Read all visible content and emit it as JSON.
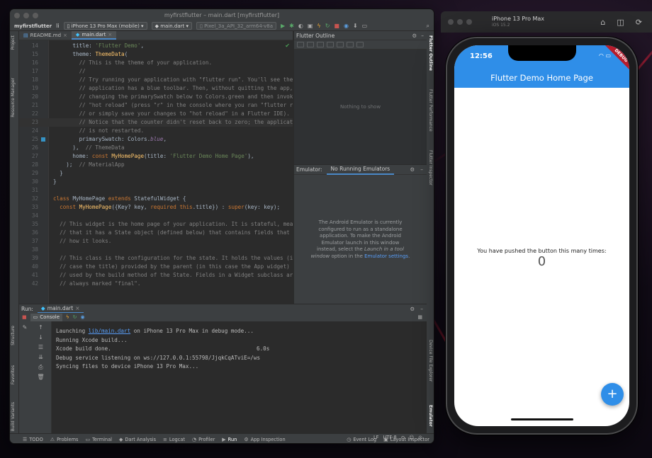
{
  "ide": {
    "title": "myfirstflutter – main.dart [myfirstflutter]",
    "breadcrumb": "myfirstflutter",
    "device_select": "iPhone 13 Pro Max (mobile)",
    "run_config": "main.dart",
    "avd_select": "Pixel_3a_API_32_arm64-v8a",
    "left_tabs": [
      "Project",
      "Resource Manager",
      "Structure",
      "Favorites",
      "Build Variants"
    ],
    "right_tabs": [
      "Flutter Outline",
      "Flutter Performance",
      "Flutter Inspector",
      "Device File Explorer",
      "Emulator"
    ]
  },
  "editor": {
    "tabs": [
      {
        "label": "README.md",
        "active": false
      },
      {
        "label": "main.dart",
        "active": true
      }
    ],
    "lines": [
      {
        "n": "14",
        "tokens": [
          [
            "",
            "      title: "
          ],
          [
            "s",
            "'Flutter Demo'"
          ],
          [
            "",
            ","
          ]
        ]
      },
      {
        "n": "15",
        "tokens": [
          [
            "",
            "      theme: "
          ],
          [
            "f",
            "ThemeData"
          ],
          [
            "",
            "("
          ]
        ]
      },
      {
        "n": "16",
        "tokens": [
          [
            "c",
            "        // This is the theme of your application."
          ]
        ]
      },
      {
        "n": "17",
        "tokens": [
          [
            "c",
            "        //"
          ]
        ]
      },
      {
        "n": "18",
        "tokens": [
          [
            "c",
            "        // Try running your application with \"flutter run\". You'll see the"
          ]
        ]
      },
      {
        "n": "19",
        "tokens": [
          [
            "c",
            "        // application has a blue toolbar. Then, without quitting the app,"
          ]
        ]
      },
      {
        "n": "20",
        "tokens": [
          [
            "c",
            "        // changing the primarySwatch below to Colors.green and then invoke"
          ]
        ]
      },
      {
        "n": "21",
        "tokens": [
          [
            "c",
            "        // \"hot reload\" (press \"r\" in the console where you ran \"flutter run"
          ]
        ]
      },
      {
        "n": "22",
        "tokens": [
          [
            "c",
            "        // or simply save your changes to \"hot reload\" in a Flutter IDE)."
          ]
        ]
      },
      {
        "n": "23",
        "tokens": [
          [
            "c",
            "        // Notice that the counter didn't reset back to zero; the applicat"
          ]
        ],
        "current": true
      },
      {
        "n": "24",
        "tokens": [
          [
            "c",
            "        // is not restarted."
          ]
        ]
      },
      {
        "n": "25",
        "tokens": [
          [
            "",
            "        primarySwatch: Colors."
          ],
          [
            "p",
            "blue"
          ],
          [
            "",
            ","
          ]
        ],
        "marker": true
      },
      {
        "n": "26",
        "tokens": [
          [
            "",
            "      ),  "
          ],
          [
            "c",
            "// ThemeData"
          ]
        ]
      },
      {
        "n": "27",
        "tokens": [
          [
            "",
            "      home: "
          ],
          [
            "k",
            "const "
          ],
          [
            "f",
            "MyHomePage"
          ],
          [
            "",
            "(title: "
          ],
          [
            "s",
            "'Flutter Demo Home Page'"
          ],
          [
            "",
            "),"
          ]
        ]
      },
      {
        "n": "28",
        "tokens": [
          [
            "",
            "    );  "
          ],
          [
            "c",
            "// MaterialApp"
          ]
        ]
      },
      {
        "n": "29",
        "tokens": [
          [
            "",
            "  }"
          ]
        ]
      },
      {
        "n": "30",
        "tokens": [
          [
            "",
            "}"
          ]
        ]
      },
      {
        "n": "31",
        "tokens": [
          [
            "",
            ""
          ]
        ]
      },
      {
        "n": "32",
        "tokens": [
          [
            "k",
            "class "
          ],
          [
            "",
            "MyHomePage "
          ],
          [
            "k",
            "extends "
          ],
          [
            "",
            "StatefulWidget {"
          ]
        ]
      },
      {
        "n": "33",
        "tokens": [
          [
            "",
            "  "
          ],
          [
            "k",
            "const "
          ],
          [
            "f",
            "MyHomePage"
          ],
          [
            "",
            "({Key? key, "
          ],
          [
            "k",
            "required this"
          ],
          [
            "",
            ".title}) : "
          ],
          [
            "k",
            "super"
          ],
          [
            "",
            "(key: key);"
          ]
        ]
      },
      {
        "n": "34",
        "tokens": [
          [
            "",
            ""
          ]
        ]
      },
      {
        "n": "35",
        "tokens": [
          [
            "c",
            "  // This widget is the home page of your application. It is stateful, mean"
          ]
        ]
      },
      {
        "n": "36",
        "tokens": [
          [
            "c",
            "  // that it has a State object (defined below) that contains fields that a"
          ]
        ]
      },
      {
        "n": "37",
        "tokens": [
          [
            "c",
            "  // how it looks."
          ]
        ]
      },
      {
        "n": "38",
        "tokens": [
          [
            "",
            ""
          ]
        ]
      },
      {
        "n": "39",
        "tokens": [
          [
            "c",
            "  // This class is the configuration for the state. It holds the values (i"
          ]
        ]
      },
      {
        "n": "40",
        "tokens": [
          [
            "c",
            "  // case the title) provided by the parent (in this case the App widget) a"
          ]
        ]
      },
      {
        "n": "41",
        "tokens": [
          [
            "c",
            "  // used by the build method of the State. Fields in a Widget subclass are"
          ]
        ]
      },
      {
        "n": "42",
        "tokens": [
          [
            "c",
            "  // always marked \"final\"."
          ]
        ]
      }
    ]
  },
  "outline": {
    "title": "Flutter Outline",
    "empty_text": "Nothing to show"
  },
  "emulator": {
    "label": "Emulator:",
    "tab": "No Running Emulators",
    "msg_1": "The Android Emulator is currently configured to run as a standalone application. To make the Android Emulator launch in this window instead, select the ",
    "msg_italic": "Launch in a tool window",
    "msg_2": " option in the ",
    "msg_link": "Emulator settings",
    "msg_3": "."
  },
  "run": {
    "label": "Run:",
    "tab": "main.dart",
    "console_tab": "Console",
    "lines": [
      {
        "pre": "Launching ",
        "link": "lib/main.dart",
        "post": " on iPhone 13 Pro Max in debug mode..."
      },
      {
        "pre": "Running Xcode build..."
      },
      {
        "pre": "Xcode build done.",
        "dur": "6.0s"
      },
      {
        "pre": "Debug service listening on ws://127.0.0.1:55798/JjqkCqATviE=/ws"
      },
      {
        "pre": "Syncing files to device iPhone 13 Pro Max..."
      }
    ]
  },
  "bottom_bar": {
    "todo": "TODO",
    "problems": "Problems",
    "terminal": "Terminal",
    "dart_analysis": "Dart Analysis",
    "logcat": "Logcat",
    "profiler": "Profiler",
    "run": "Run",
    "app_inspection": "App Inspection",
    "event_log": "Event Log",
    "layout_inspector": "Layout Inspector",
    "line_sep": "LF",
    "encoding": "UTF-8"
  },
  "simulator": {
    "device_name": "iPhone 13 Pro Max",
    "os_version": "iOS 15.2",
    "status_time": "12:56",
    "debug_banner": "DEBUG",
    "app_title": "Flutter Demo Home Page",
    "counter_label": "You have pushed the button this many times:",
    "counter_value": "0",
    "fab_icon": "+"
  }
}
